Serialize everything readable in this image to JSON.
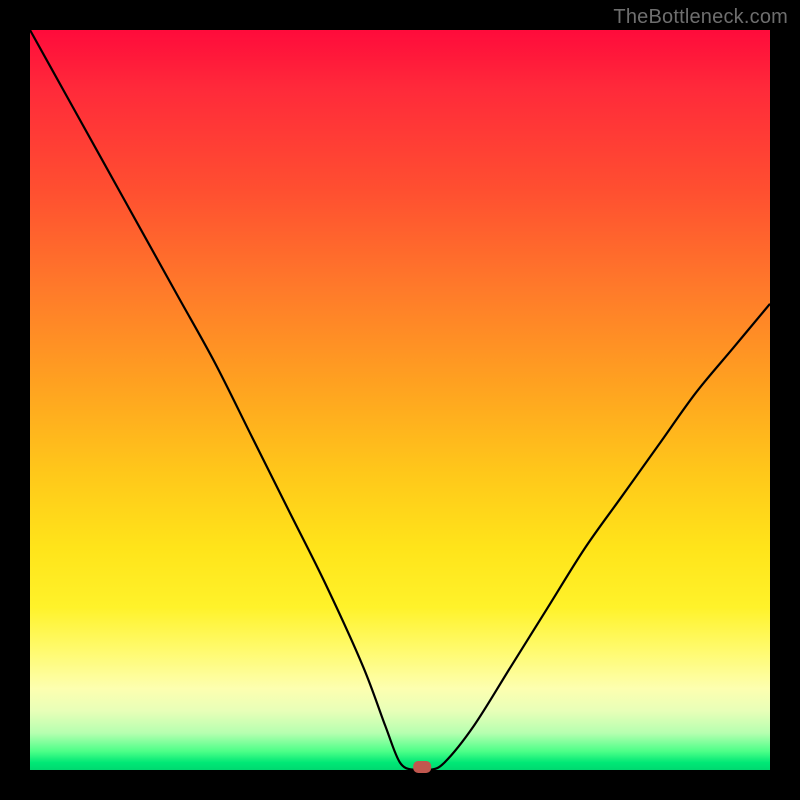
{
  "attribution": "TheBottleneck.com",
  "chart_data": {
    "type": "line",
    "title": "",
    "xlabel": "",
    "ylabel": "",
    "xlim": [
      0,
      100
    ],
    "ylim": [
      0,
      100
    ],
    "grid": false,
    "legend": false,
    "series": [
      {
        "name": "bottleneck-curve",
        "x": [
          0,
          5,
          10,
          15,
          20,
          25,
          30,
          35,
          40,
          45,
          48,
          50,
          52,
          54,
          56,
          60,
          65,
          70,
          75,
          80,
          85,
          90,
          95,
          100
        ],
        "y": [
          100,
          91,
          82,
          73,
          64,
          55,
          45,
          35,
          25,
          14,
          6,
          1,
          0,
          0,
          1,
          6,
          14,
          22,
          30,
          37,
          44,
          51,
          57,
          63
        ]
      }
    ],
    "marker": {
      "x": 53,
      "y": 0,
      "shape": "rounded-rect",
      "color": "#c0574e"
    },
    "background_gradient": {
      "direction": "top-to-bottom",
      "stops": [
        {
          "pos": 0.0,
          "color": "#ff0b3b"
        },
        {
          "pos": 0.5,
          "color": "#ffb020"
        },
        {
          "pos": 0.8,
          "color": "#fff22a"
        },
        {
          "pos": 0.95,
          "color": "#b6ffb0"
        },
        {
          "pos": 1.0,
          "color": "#00d870"
        }
      ]
    }
  }
}
